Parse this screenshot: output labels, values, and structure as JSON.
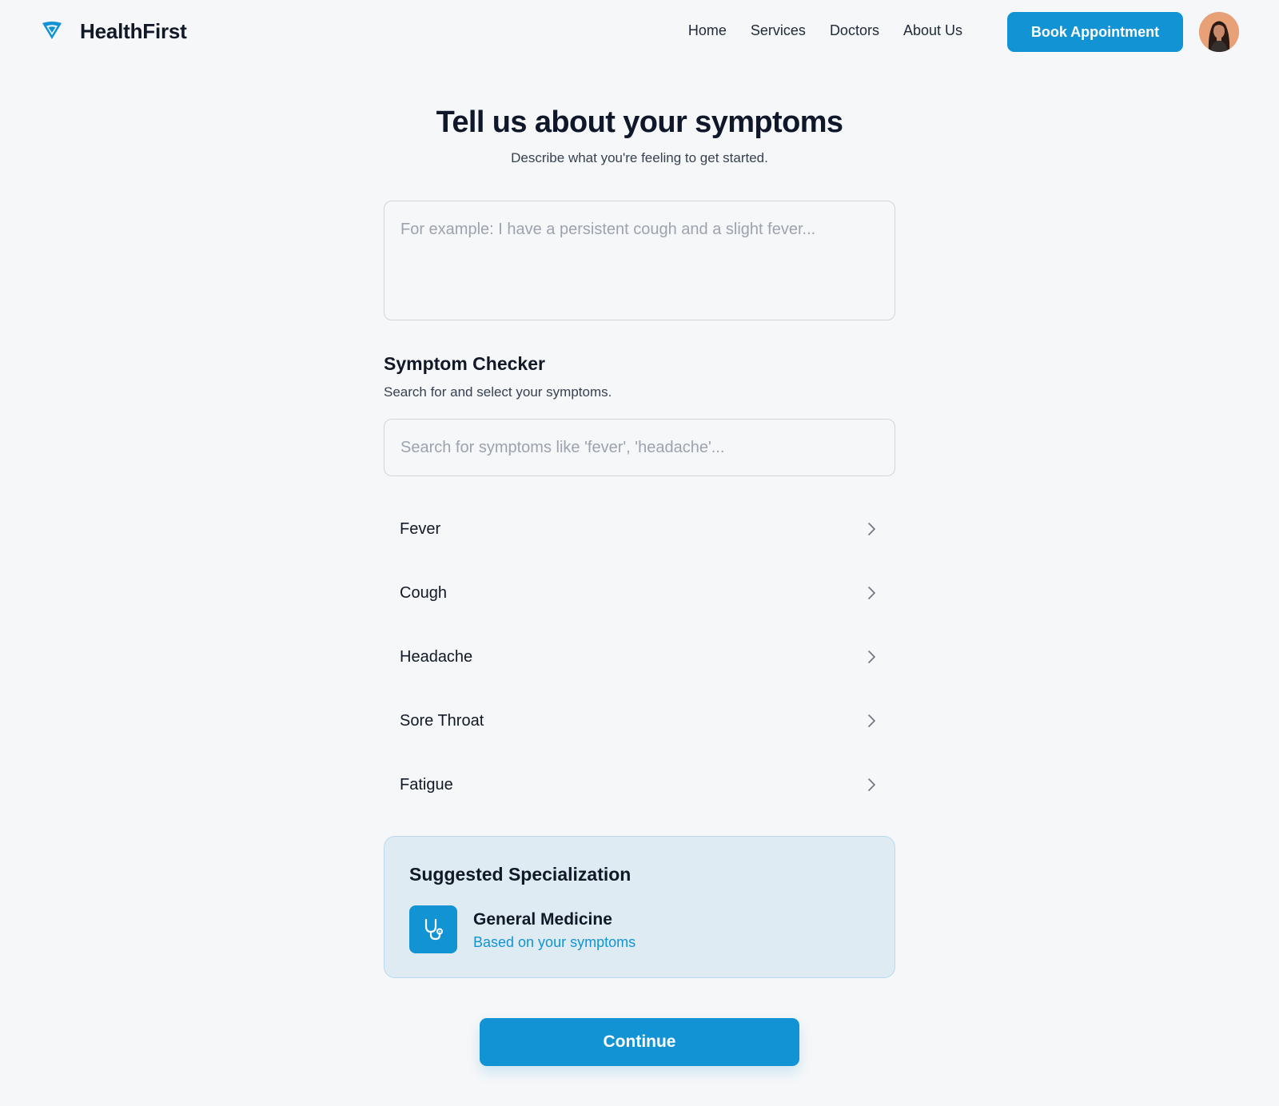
{
  "brand": {
    "name": "HealthFirst",
    "logo_icon": "shield-drop-icon",
    "accent_color": "#1193d4"
  },
  "nav": {
    "items": [
      {
        "label": "Home"
      },
      {
        "label": "Services"
      },
      {
        "label": "Doctors"
      },
      {
        "label": "About Us"
      }
    ],
    "cta_label": "Book Appointment",
    "avatar": "user-avatar"
  },
  "page": {
    "title": "Tell us about your symptoms",
    "subtitle": "Describe what you're feeling to get started.",
    "describe_placeholder": "For example: I have a persistent cough and a slight fever...",
    "describe_value": ""
  },
  "symptom_checker": {
    "title": "Symptom Checker",
    "subtitle": "Search for and select your symptoms.",
    "search_placeholder": "Search for symptoms like 'fever', 'headache'...",
    "search_value": "",
    "items": [
      {
        "label": "Fever",
        "icon": "chevron-right-icon"
      },
      {
        "label": "Cough",
        "icon": "chevron-right-icon"
      },
      {
        "label": "Headache",
        "icon": "chevron-right-icon"
      },
      {
        "label": "Sore Throat",
        "icon": "chevron-right-icon"
      },
      {
        "label": "Fatigue",
        "icon": "chevron-right-icon"
      }
    ]
  },
  "suggestion": {
    "title": "Suggested Specialization",
    "specialization": "General Medicine",
    "note": "Based on your symptoms",
    "icon": "stethoscope-icon"
  },
  "continue_label": "Continue"
}
